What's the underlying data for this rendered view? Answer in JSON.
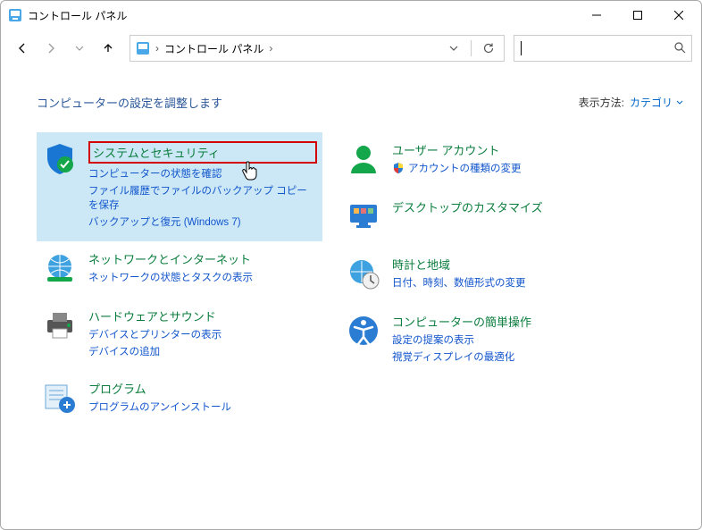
{
  "window": {
    "title": "コントロール パネル"
  },
  "address": {
    "path": "コントロール パネル",
    "sep": "›"
  },
  "heading": "コンピューターの設定を調整します",
  "view": {
    "label": "表示方法:",
    "value": "カテゴリ"
  },
  "left": [
    {
      "title": "システムとセキュリティ",
      "links": [
        "コンピューターの状態を確認",
        "ファイル履歴でファイルのバックアップ コピーを保存",
        "バックアップと復元 (Windows 7)"
      ]
    },
    {
      "title": "ネットワークとインターネット",
      "links": [
        "ネットワークの状態とタスクの表示"
      ]
    },
    {
      "title": "ハードウェアとサウンド",
      "links": [
        "デバイスとプリンターの表示",
        "デバイスの追加"
      ]
    },
    {
      "title": "プログラム",
      "links": [
        "プログラムのアンインストール"
      ]
    }
  ],
  "right": [
    {
      "title": "ユーザー アカウント",
      "links": [
        "アカウントの種類の変更"
      ],
      "shield": true
    },
    {
      "title": "デスクトップのカスタマイズ",
      "links": []
    },
    {
      "title": "時計と地域",
      "links": [
        "日付、時刻、数値形式の変更"
      ]
    },
    {
      "title": "コンピューターの簡単操作",
      "links": [
        "設定の提案の表示",
        "視覚ディスプレイの最適化"
      ]
    }
  ]
}
